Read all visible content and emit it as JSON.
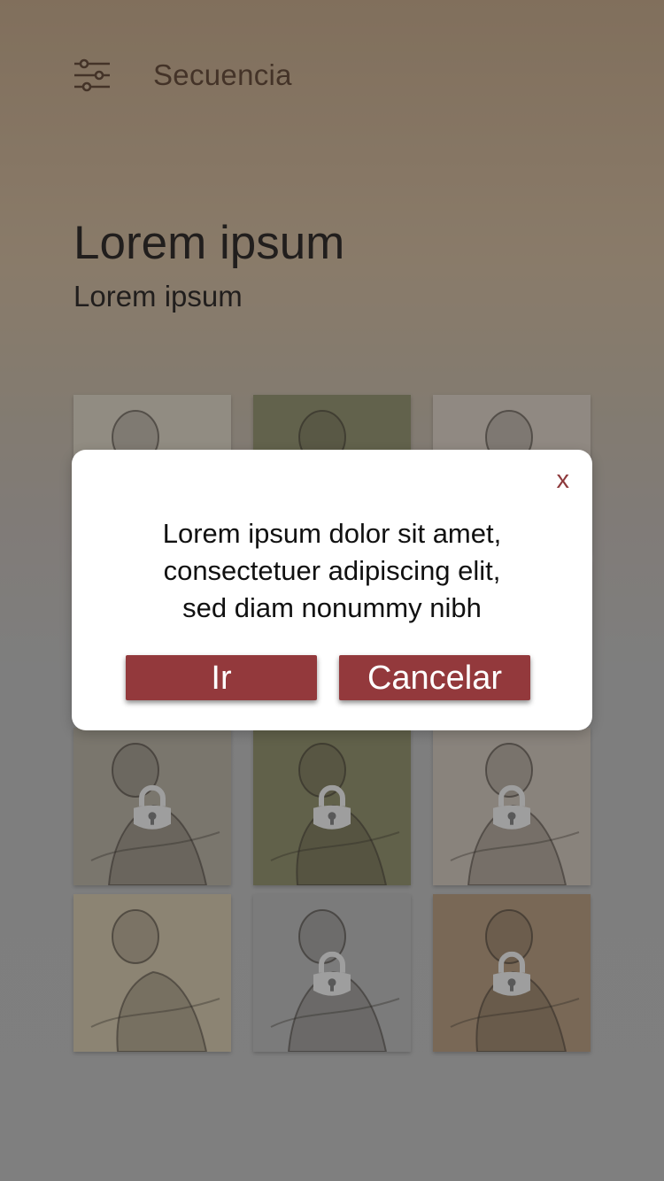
{
  "header": {
    "title": "Secuencia",
    "filter_icon": "sliders-icon"
  },
  "content": {
    "title": "Lorem ipsum",
    "subtitle": "Lorem ipsum"
  },
  "gallery": {
    "tiles": [
      {
        "locked": false,
        "bg": "#cfc6b6"
      },
      {
        "locked": false,
        "bg": "#7f7f59"
      },
      {
        "locked": false,
        "bg": "#cdc2b6"
      },
      {
        "locked": true,
        "bg": "#cfc6b6"
      },
      {
        "locked": true,
        "bg": "#7d7c55"
      },
      {
        "locked": true,
        "bg": "#c2b7ab"
      },
      {
        "locked": true,
        "bg": "#a8a092"
      },
      {
        "locked": true,
        "bg": "#7d7c55"
      },
      {
        "locked": true,
        "bg": "#c2b7ab"
      },
      {
        "locked": false,
        "bg": "#c6b89c"
      },
      {
        "locked": true,
        "bg": "#a9a9a9"
      },
      {
        "locked": true,
        "bg": "#a6896a"
      }
    ]
  },
  "modal": {
    "close_label": "x",
    "lines": [
      "Lorem ipsum dolor sit amet,",
      "consectetuer adipiscing elit,",
      "sed diam nonummy nibh"
    ],
    "go_label": "Ir",
    "cancel_label": "Cancelar"
  },
  "colors": {
    "accent": "#93393c",
    "header_text": "#4a2e1a",
    "lock": "#e6e6e6"
  }
}
